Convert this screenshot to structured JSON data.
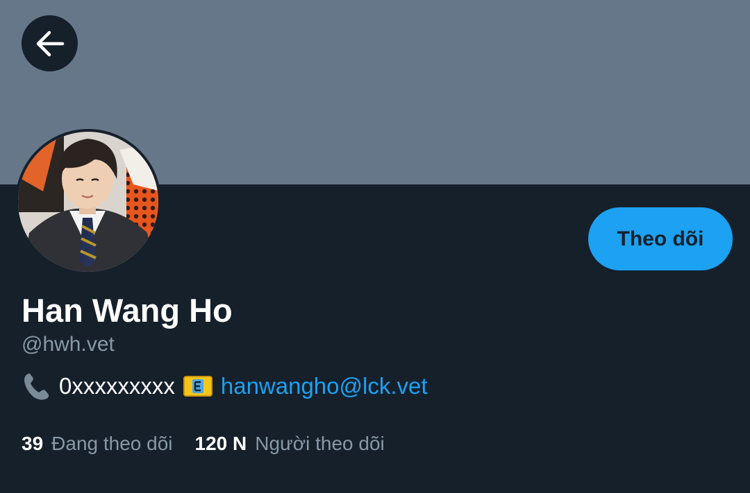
{
  "profile": {
    "display_name": "Han Wang Ho",
    "handle": "@hwh.vet",
    "follow_button_label": "Theo dõi",
    "bio": {
      "phone": "0xxxxxxxxx",
      "email": "hanwangho@lck.vet"
    },
    "stats": {
      "following_count": "39",
      "following_label": "Đang theo dõi",
      "followers_count": "120 N",
      "followers_label": "Người theo dõi"
    }
  },
  "icons": {
    "back": "arrow-left-icon",
    "phone": "telephone-receiver-icon",
    "email": "e-mail-icon"
  },
  "colors": {
    "banner": "#66778a",
    "background": "#15202b",
    "accent": "#1da1f2",
    "secondary_text": "#8899a6"
  }
}
